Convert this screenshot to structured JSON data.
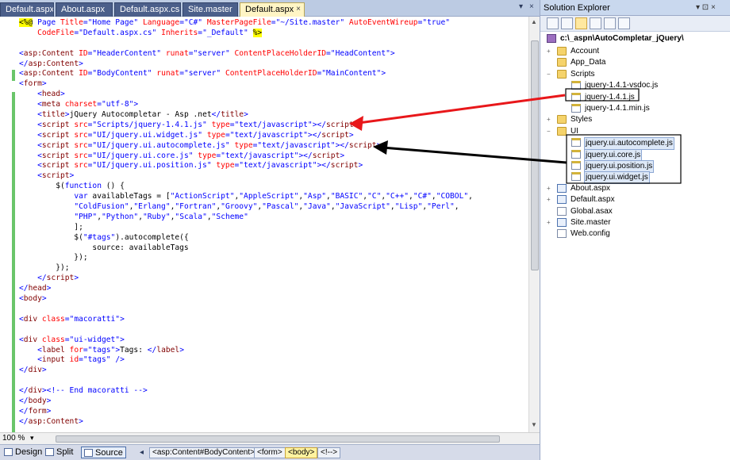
{
  "tabs": [
    {
      "label": "Default.aspx",
      "active": false
    },
    {
      "label": "About.aspx",
      "active": false
    },
    {
      "label": "Default.aspx.cs",
      "active": false
    },
    {
      "label": "Site.master",
      "active": false
    },
    {
      "label": "Default.aspx",
      "active": true
    }
  ],
  "tab_close_glyph": "×",
  "code_lines": [
    [
      [
        "dir",
        "<%@"
      ],
      [
        "kw",
        " Page "
      ],
      [
        "attr",
        "Title"
      ],
      [
        "kw",
        "="
      ],
      [
        "str",
        "\"Home Page\""
      ],
      [
        "attr",
        " Language"
      ],
      [
        "kw",
        "="
      ],
      [
        "str",
        "\"C#\""
      ],
      [
        "attr",
        " MasterPageFile"
      ],
      [
        "kw",
        "="
      ],
      [
        "str",
        "\"~/Site.master\""
      ],
      [
        "attr",
        " AutoEventWireup"
      ],
      [
        "kw",
        "="
      ],
      [
        "str",
        "\"true\""
      ]
    ],
    [
      [
        "plain",
        "    "
      ],
      [
        "attr",
        "CodeFile"
      ],
      [
        "kw",
        "="
      ],
      [
        "str",
        "\"Default.aspx.cs\""
      ],
      [
        "attr",
        " Inherits"
      ],
      [
        "kw",
        "="
      ],
      [
        "str",
        "\"_Default\""
      ],
      [
        "plain",
        " "
      ],
      [
        "dir",
        "%>"
      ]
    ],
    [
      [
        "plain",
        ""
      ]
    ],
    [
      [
        "kw",
        "<"
      ],
      [
        "tag",
        "asp:Content"
      ],
      [
        "attr",
        " ID"
      ],
      [
        "kw",
        "=\"HeaderContent\""
      ],
      [
        "attr",
        " runat"
      ],
      [
        "kw",
        "=\"server\""
      ],
      [
        "attr",
        " ContentPlaceHolderID"
      ],
      [
        "kw",
        "=\"HeadContent\">"
      ]
    ],
    [
      [
        "kw",
        "</"
      ],
      [
        "tag",
        "asp:Content"
      ],
      [
        "kw",
        ">"
      ]
    ],
    [
      [
        "kw",
        "<"
      ],
      [
        "tag",
        "asp:Content"
      ],
      [
        "attr",
        " ID"
      ],
      [
        "kw",
        "=\"BodyContent\""
      ],
      [
        "attr",
        " runat"
      ],
      [
        "kw",
        "=\"server\""
      ],
      [
        "attr",
        " ContentPlaceHolderID"
      ],
      [
        "kw",
        "=\"MainContent\">"
      ]
    ],
    [
      [
        "kw",
        "<"
      ],
      [
        "tag",
        "form"
      ],
      [
        "kw",
        ">"
      ]
    ],
    [
      [
        "plain",
        "    "
      ],
      [
        "kw",
        "<"
      ],
      [
        "tag",
        "head"
      ],
      [
        "kw",
        ">"
      ]
    ],
    [
      [
        "plain",
        "    "
      ],
      [
        "kw",
        "<"
      ],
      [
        "tag",
        "meta"
      ],
      [
        "attr",
        " charset"
      ],
      [
        "kw",
        "=\"utf-8\">"
      ]
    ],
    [
      [
        "plain",
        "    "
      ],
      [
        "kw",
        "<"
      ],
      [
        "tag",
        "title"
      ],
      [
        "kw",
        ">"
      ],
      [
        "plain",
        "jQuery Autocompletar - Asp .net"
      ],
      [
        "kw",
        "</"
      ],
      [
        "tag",
        "title"
      ],
      [
        "kw",
        ">"
      ]
    ],
    [
      [
        "plain",
        "    "
      ],
      [
        "kw",
        "<"
      ],
      [
        "tag",
        "script"
      ],
      [
        "attr",
        " src"
      ],
      [
        "kw",
        "=\"Scripts/jquery-1.4.1.js\""
      ],
      [
        "attr",
        " type"
      ],
      [
        "kw",
        "=\"text/javascript\"></"
      ],
      [
        "tag",
        "script"
      ],
      [
        "kw",
        ">"
      ]
    ],
    [
      [
        "plain",
        "    "
      ],
      [
        "kw",
        "<"
      ],
      [
        "tag",
        "script"
      ],
      [
        "attr",
        " src"
      ],
      [
        "kw",
        "=\"UI/jquery.ui.widget.js\""
      ],
      [
        "attr",
        " type"
      ],
      [
        "kw",
        "=\"text/javascript\"></"
      ],
      [
        "tag",
        "script"
      ],
      [
        "kw",
        ">"
      ]
    ],
    [
      [
        "plain",
        "    "
      ],
      [
        "kw",
        "<"
      ],
      [
        "tag",
        "script"
      ],
      [
        "attr",
        " src"
      ],
      [
        "kw",
        "=\"UI/jquery.ui.autocomplete.js\""
      ],
      [
        "attr",
        " type"
      ],
      [
        "kw",
        "=\"text/javascript\"></"
      ],
      [
        "tag",
        "script"
      ],
      [
        "kw",
        ">"
      ]
    ],
    [
      [
        "plain",
        "    "
      ],
      [
        "kw",
        "<"
      ],
      [
        "tag",
        "script"
      ],
      [
        "attr",
        " src"
      ],
      [
        "kw",
        "=\"UI/jquery.ui.core.js\""
      ],
      [
        "attr",
        " type"
      ],
      [
        "kw",
        "=\"text/javascript\"></"
      ],
      [
        "tag",
        "script"
      ],
      [
        "kw",
        ">"
      ]
    ],
    [
      [
        "plain",
        "    "
      ],
      [
        "kw",
        "<"
      ],
      [
        "tag",
        "script"
      ],
      [
        "attr",
        " src"
      ],
      [
        "kw",
        "=\"UI/jquery.ui.position.js\""
      ],
      [
        "attr",
        " type"
      ],
      [
        "kw",
        "=\"text/javascript\"></"
      ],
      [
        "tag",
        "script"
      ],
      [
        "kw",
        ">"
      ]
    ],
    [
      [
        "plain",
        "    "
      ],
      [
        "kw",
        "<"
      ],
      [
        "tag",
        "script"
      ],
      [
        "kw",
        ">"
      ]
    ],
    [
      [
        "plain",
        "        $("
      ],
      [
        "kw",
        "function"
      ],
      [
        "plain",
        " () {"
      ]
    ],
    [
      [
        "plain",
        "            "
      ],
      [
        "kw",
        "var"
      ],
      [
        "plain",
        " availableTags = ["
      ],
      [
        "str",
        "\"ActionScript\""
      ],
      [
        "plain",
        ","
      ],
      [
        "str",
        "\"AppleScript\""
      ],
      [
        "plain",
        ","
      ],
      [
        "str",
        "\"Asp\""
      ],
      [
        "plain",
        ","
      ],
      [
        "str",
        "\"BASIC\""
      ],
      [
        "plain",
        ","
      ],
      [
        "str",
        "\"C\""
      ],
      [
        "plain",
        ","
      ],
      [
        "str",
        "\"C++\""
      ],
      [
        "plain",
        ","
      ],
      [
        "str",
        "\"C#\""
      ],
      [
        "plain",
        ","
      ],
      [
        "str",
        "\"COBOL\""
      ],
      [
        "plain",
        ","
      ]
    ],
    [
      [
        "plain",
        "            "
      ],
      [
        "str",
        "\"ColdFusion\""
      ],
      [
        "plain",
        ","
      ],
      [
        "str",
        "\"Erlang\""
      ],
      [
        "plain",
        ","
      ],
      [
        "str",
        "\"Fortran\""
      ],
      [
        "plain",
        ","
      ],
      [
        "str",
        "\"Groovy\""
      ],
      [
        "plain",
        ","
      ],
      [
        "str",
        "\"Pascal\""
      ],
      [
        "plain",
        ","
      ],
      [
        "str",
        "\"Java\""
      ],
      [
        "plain",
        ","
      ],
      [
        "str",
        "\"JavaScript\""
      ],
      [
        "plain",
        ","
      ],
      [
        "str",
        "\"Lisp\""
      ],
      [
        "plain",
        ","
      ],
      [
        "str",
        "\"Perl\""
      ],
      [
        "plain",
        ","
      ]
    ],
    [
      [
        "plain",
        "            "
      ],
      [
        "str",
        "\"PHP\""
      ],
      [
        "plain",
        ","
      ],
      [
        "str",
        "\"Python\""
      ],
      [
        "plain",
        ","
      ],
      [
        "str",
        "\"Ruby\""
      ],
      [
        "plain",
        ","
      ],
      [
        "str",
        "\"Scala\""
      ],
      [
        "plain",
        ","
      ],
      [
        "str",
        "\"Scheme\""
      ]
    ],
    [
      [
        "plain",
        "            ];"
      ]
    ],
    [
      [
        "plain",
        "            $("
      ],
      [
        "str",
        "\"#tags\""
      ],
      [
        "plain",
        ").autocomplete({"
      ]
    ],
    [
      [
        "plain",
        "                source: availableTags"
      ]
    ],
    [
      [
        "plain",
        "            });"
      ]
    ],
    [
      [
        "plain",
        "        });"
      ]
    ],
    [
      [
        "plain",
        "    "
      ],
      [
        "kw",
        "</"
      ],
      [
        "tag",
        "script"
      ],
      [
        "kw",
        ">"
      ]
    ],
    [
      [
        "kw",
        "</"
      ],
      [
        "tag",
        "head"
      ],
      [
        "kw",
        ">"
      ]
    ],
    [
      [
        "kw",
        "<"
      ],
      [
        "tag",
        "body"
      ],
      [
        "kw",
        ">"
      ]
    ],
    [
      [
        "plain",
        ""
      ]
    ],
    [
      [
        "kw",
        "<"
      ],
      [
        "tag",
        "div"
      ],
      [
        "attr",
        " class"
      ],
      [
        "kw",
        "=\"macoratti\">"
      ]
    ],
    [
      [
        "plain",
        ""
      ]
    ],
    [
      [
        "kw",
        "<"
      ],
      [
        "tag",
        "div"
      ],
      [
        "attr",
        " class"
      ],
      [
        "kw",
        "=\"ui-widget\">"
      ]
    ],
    [
      [
        "plain",
        "    "
      ],
      [
        "kw",
        "<"
      ],
      [
        "tag",
        "label"
      ],
      [
        "attr",
        " for"
      ],
      [
        "kw",
        "=\"tags\">"
      ],
      [
        "plain",
        "Tags: "
      ],
      [
        "kw",
        "</"
      ],
      [
        "tag",
        "label"
      ],
      [
        "kw",
        ">"
      ]
    ],
    [
      [
        "plain",
        "    "
      ],
      [
        "kw",
        "<"
      ],
      [
        "tag",
        "input"
      ],
      [
        "attr",
        " id"
      ],
      [
        "kw",
        "=\"tags\" />"
      ]
    ],
    [
      [
        "kw",
        "</"
      ],
      [
        "tag",
        "div"
      ],
      [
        "kw",
        ">"
      ]
    ],
    [
      [
        "plain",
        ""
      ]
    ],
    [
      [
        "kw",
        "</"
      ],
      [
        "tag",
        "div"
      ],
      [
        "kw",
        ">"
      ],
      [
        "kw",
        "<!-- End macoratti -->"
      ]
    ],
    [
      [
        "kw",
        "</"
      ],
      [
        "tag",
        "body"
      ],
      [
        "kw",
        ">"
      ]
    ],
    [
      [
        "kw",
        "</"
      ],
      [
        "tag",
        "form"
      ],
      [
        "kw",
        ">"
      ]
    ],
    [
      [
        "kw",
        "</"
      ],
      [
        "tag",
        "asp:Content"
      ],
      [
        "kw",
        ">"
      ]
    ]
  ],
  "token_colors": {
    "kw": "#0000ff",
    "tag": "#800000",
    "attr": "#ff0000",
    "str": "#0000ff",
    "plain": "#000000",
    "dir": "#000000"
  },
  "statusbar": {
    "zoom": "100 %",
    "views": [
      "Design",
      "Split",
      "Source"
    ],
    "active_view": "Source",
    "breadcrumbs": [
      "<asp:Content#BodyContent>",
      "<form>",
      "<body>",
      "<!-->"
    ],
    "selected_crumb": "<body>"
  },
  "solution_explorer": {
    "title": "Solution Explorer",
    "pin_glyph": "▾ ⊡ ×",
    "project": "c:\\_aspn\\AutoCompletar_jQuery\\",
    "items": [
      {
        "label": "Account",
        "type": "folder",
        "expander": "+"
      },
      {
        "label": "App_Data",
        "type": "folder",
        "expander": ""
      },
      {
        "label": "Scripts",
        "type": "folder",
        "expander": "−"
      },
      {
        "label": "jquery-1.4.1-vsdoc.js",
        "type": "js",
        "expander": ""
      },
      {
        "label": "jquery-1.4.1.js",
        "type": "js",
        "expander": ""
      },
      {
        "label": "jquery-1.4.1.min.js",
        "type": "js",
        "expander": ""
      },
      {
        "label": "Styles",
        "type": "folder",
        "expander": "+"
      },
      {
        "label": "UI",
        "type": "folder",
        "expander": "−"
      },
      {
        "label": "jquery.ui.autocomplete.js",
        "type": "js",
        "expander": ""
      },
      {
        "label": "jquery.ui.core.js",
        "type": "js",
        "expander": ""
      },
      {
        "label": "jquery.ui.position.js",
        "type": "js",
        "expander": ""
      },
      {
        "label": "jquery.ui.widget.js",
        "type": "js",
        "expander": ""
      },
      {
        "label": "About.aspx",
        "type": "page",
        "expander": "+"
      },
      {
        "label": "Default.aspx",
        "type": "page",
        "expander": "+"
      },
      {
        "label": "Global.asax",
        "type": "file",
        "expander": ""
      },
      {
        "label": "Site.master",
        "type": "page",
        "expander": "+"
      },
      {
        "label": "Web.config",
        "type": "file",
        "expander": ""
      }
    ]
  },
  "annotation_colors": {
    "red_arrow": "#e8171a",
    "black_arrow": "#000000"
  }
}
